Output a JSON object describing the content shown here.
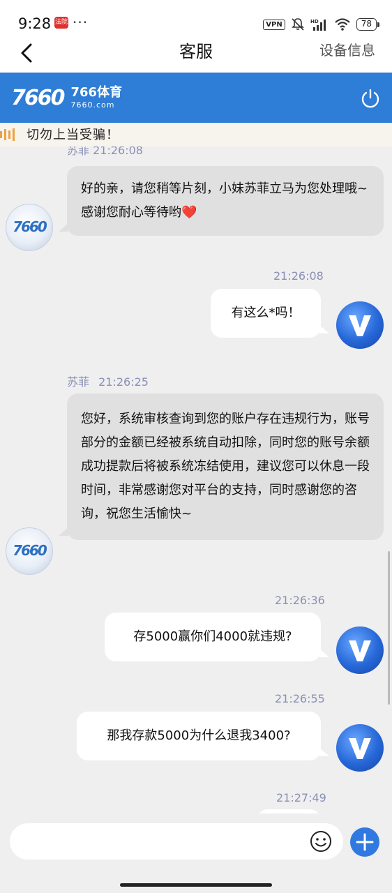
{
  "status_bar": {
    "time": "9:28",
    "app_badge": "法院",
    "more": "···",
    "vpn": "VPN",
    "battery": "78"
  },
  "nav": {
    "title": "客服",
    "device_info": "设备信息"
  },
  "brand": {
    "logo_number": "7660",
    "name": "766体育",
    "domain": "7660.com",
    "accent_color": "#2e7dd6"
  },
  "notice": {
    "text": "切勿上当受骗！"
  },
  "chat": {
    "cut_meta": "苏菲 21:26:08",
    "messages": [
      {
        "side": "agent",
        "text": "好的亲，请您稍等片刻，小妹苏菲立马为您处理哦~感谢您耐心等待哟❤️"
      },
      {
        "side": "user",
        "time": "21:26:08",
        "text": "有这么*吗！"
      },
      {
        "side": "agent",
        "sender": "苏菲",
        "time": "21:26:25",
        "text": "您好，系统审核查询到您的账户存在违规行为，账号部分的金额已经被系统自动扣除，同时您的账号余额成功提款后将被系统冻结使用，建议您可以休息一段时间，非常感谢您对平台的支持，同时感谢您的咨询，祝您生活愉快~"
      },
      {
        "side": "user",
        "time": "21:26:36",
        "text": "存5000赢你们4000就违规?"
      },
      {
        "side": "user",
        "time": "21:26:55",
        "text": "那我存款5000为什么退我3400?"
      },
      {
        "side": "user",
        "time": "21:27:49",
        "text": ""
      }
    ]
  }
}
